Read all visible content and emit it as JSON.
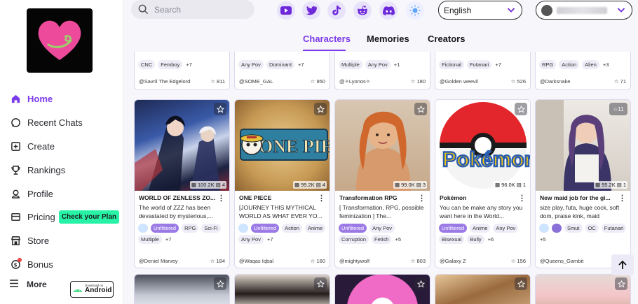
{
  "search": {
    "placeholder": "Search"
  },
  "topbar": {
    "social": [
      "youtube-icon",
      "twitter-icon",
      "tiktok-icon",
      "reddit-icon",
      "discord-icon",
      "theme-sun-icon"
    ],
    "language": "English"
  },
  "sidebar": {
    "items": [
      {
        "label": "Home",
        "icon": "home-icon"
      },
      {
        "label": "Recent Chats",
        "icon": "chat-icon"
      },
      {
        "label": "Create",
        "icon": "plus-box-icon"
      },
      {
        "label": "Rankings",
        "icon": "trophy-icon"
      },
      {
        "label": "Profile",
        "icon": "profile-icon"
      },
      {
        "label": "Pricing",
        "icon": "pricing-icon"
      },
      {
        "label": "Store",
        "icon": "store-icon"
      },
      {
        "label": "Bonus",
        "icon": "bonus-icon"
      }
    ],
    "plan_badge": "Check your Plan",
    "more": "More",
    "android_small": "Download on",
    "android_big": "Android"
  },
  "tabs": [
    "Characters",
    "Memories",
    "Creators"
  ],
  "top_cards": [
    {
      "tags": [
        "CNC",
        "Femboy",
        "+7"
      ],
      "creator": "@Savril The Edgelord",
      "likes": "811"
    },
    {
      "tags": [
        "Any Pov",
        "Dominant",
        "+7"
      ],
      "creator": "@SOME_GAL",
      "likes": "950"
    },
    {
      "tags": [
        "Multiple",
        "Any Pov",
        "+1"
      ],
      "creator": "@✧Lyonos✧",
      "likes": "180"
    },
    {
      "tags": [
        "Fictional",
        "Futanari",
        "+7"
      ],
      "creator": "@Golden weevil",
      "likes": "526"
    },
    {
      "tags": [
        "RPG",
        "Action",
        "Alien",
        "+3"
      ],
      "creator": "@Darksnake",
      "likes": "71"
    }
  ],
  "cards": [
    {
      "title": "WORLD OF ZENLESS ZO...",
      "desc": "The world of ZZZ has been devastated by mysterious,...",
      "views": "100.2K",
      "chats": "4",
      "tags": [
        "icon",
        "Unfiltered",
        "RPG",
        "Sci-Fi",
        "Multiple",
        "+7"
      ],
      "creator": "@Deniel Marvey",
      "likes": "184"
    },
    {
      "title": "ONE PIECE",
      "desc": "[JOURNEY THIS MYTHICAL WORLD AS WHAT EVER YO...",
      "views": "99.2K",
      "chats": "4",
      "tags": [
        "icon",
        "Unfiltered",
        "Action",
        "Anime",
        "Any Pov",
        "+7"
      ],
      "creator": "@Waqas Iqbal",
      "likes": "160"
    },
    {
      "title": "Transformation RPG",
      "desc": "[ Transformation, RPG, possible feminization ] The...",
      "views": "99.0K",
      "chats": "3",
      "tags": [
        "Unfiltered",
        "Any Pov",
        "Corruption",
        "Fetish",
        "+5"
      ],
      "creator": "@mightywolf",
      "likes": "803"
    },
    {
      "title": "Pokémon",
      "desc": "You can be make any story you want here in the World...",
      "views": "96.0K",
      "chats": "1",
      "tags": [
        "Unfiltered",
        "Anime",
        "Any Pov",
        "Bisexual",
        "Bully",
        "+6"
      ],
      "creator": "@Galaxy Z",
      "likes": "156"
    },
    {
      "title": "New maid job for the gi...",
      "desc": "size play, futa, huge cock, soft dom, praise kink, maid",
      "views": "95.2K",
      "chats": "1",
      "tags": [
        "icon",
        "icon2",
        "Smut",
        "OC",
        "Futanari",
        "+5"
      ],
      "creator": "@Queens_Gambit",
      "likes": "135"
    }
  ],
  "badge_11": "11",
  "colors": {
    "accent": "#7c3aed",
    "badge": "#27f2a6",
    "unfiltered": "#9b7ae6"
  }
}
